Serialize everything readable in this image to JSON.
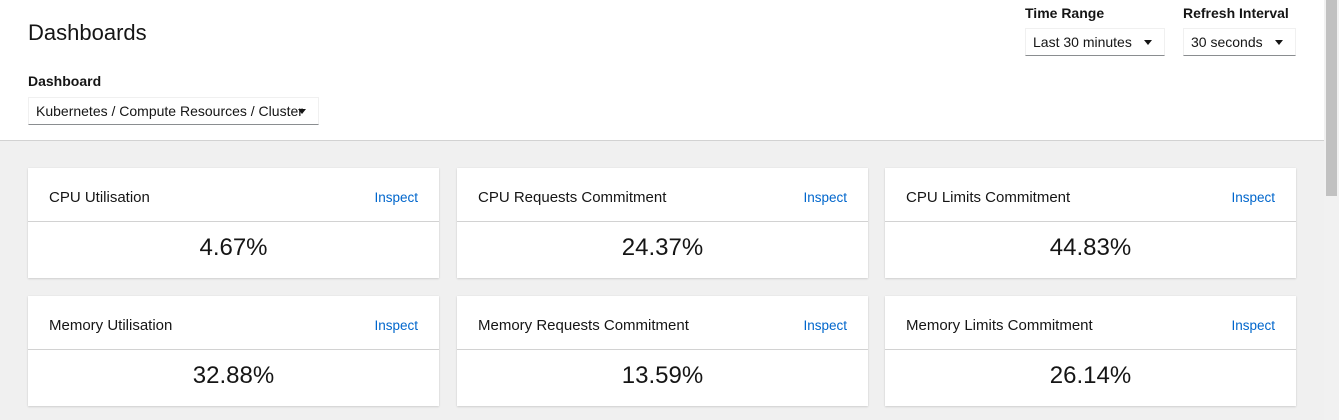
{
  "header": {
    "title": "Dashboards",
    "dashboard_label": "Dashboard",
    "dashboard_value": "Kubernetes / Compute Resources / Cluster",
    "time_range_label": "Time Range",
    "time_range_value": "Last 30 minutes",
    "refresh_label": "Refresh Interval",
    "refresh_value": "30 seconds"
  },
  "inspect_label": "Inspect",
  "cards": [
    {
      "title": "CPU Utilisation",
      "value": "4.67%"
    },
    {
      "title": "CPU Requests Commitment",
      "value": "24.37%"
    },
    {
      "title": "CPU Limits Commitment",
      "value": "44.83%"
    },
    {
      "title": "Memory Utilisation",
      "value": "32.88%"
    },
    {
      "title": "Memory Requests Commitment",
      "value": "13.59%"
    },
    {
      "title": "Memory Limits Commitment",
      "value": "26.14%"
    }
  ],
  "colors": {
    "link": "#0066cc",
    "background": "#f0f0f0",
    "card": "#ffffff"
  }
}
